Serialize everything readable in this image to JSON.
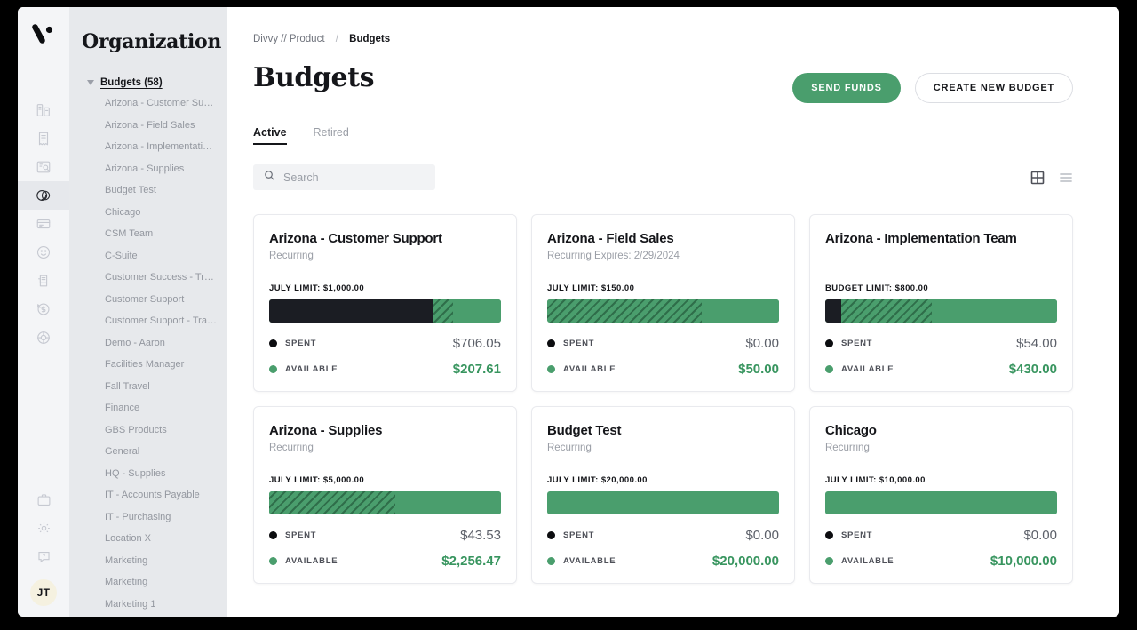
{
  "colors": {
    "accent_green": "#4a9e6d",
    "value_green": "#38955f",
    "dark": "#1b1d23"
  },
  "rail": {
    "logo": "divvy-logo",
    "icons": [
      {
        "name": "org-chart-icon"
      },
      {
        "name": "receipt-icon"
      },
      {
        "name": "transactions-icon"
      },
      {
        "name": "budgets-pie-icon",
        "active": true
      },
      {
        "name": "cards-icon"
      },
      {
        "name": "smiley-icon"
      },
      {
        "name": "bill-pay-icon"
      },
      {
        "name": "reimbursements-icon"
      },
      {
        "name": "rewards-icon"
      }
    ],
    "bottom_icons": [
      {
        "name": "briefcase-icon"
      },
      {
        "name": "gear-icon"
      },
      {
        "name": "help-icon"
      }
    ],
    "avatar_initials": "JT"
  },
  "sidebar": {
    "title": "Organization",
    "tree_label": "Budgets (58)",
    "items": [
      "Arizona - Customer Support",
      "Arizona - Field Sales",
      "Arizona - Implementation T…",
      "Arizona - Supplies",
      "Budget Test",
      "Chicago",
      "CSM Team",
      "C-Suite",
      "Customer Success - Travel …",
      "Customer Support",
      "Customer Support - Travel …",
      "Demo - Aaron",
      "Facilities Manager",
      "Fall Travel",
      "Finance",
      "GBS Products",
      "General",
      "HQ - Supplies",
      "IT - Accounts Payable",
      "IT - Purchasing",
      "Location X",
      "Marketing",
      "Marketing",
      "Marketing 1"
    ]
  },
  "breadcrumb": {
    "root": "Divvy // Product",
    "separator": "/",
    "current": "Budgets"
  },
  "header": {
    "title": "Budgets",
    "send_funds_label": "SEND FUNDS",
    "create_budget_label": "CREATE NEW BUDGET"
  },
  "tabs": [
    {
      "label": "Active",
      "active": true
    },
    {
      "label": "Retired",
      "active": false
    }
  ],
  "search": {
    "placeholder": "Search",
    "value": "",
    "icon": "search-icon"
  },
  "view_toggles": [
    {
      "name": "grid-view-icon",
      "active": true
    },
    {
      "name": "list-view-icon",
      "active": false
    }
  ],
  "cards": [
    {
      "title": "Arizona - Customer Support",
      "subtitle": "Recurring",
      "limit_label": "JULY LIMIT: $1,000.00",
      "spent_label": "SPENT",
      "spent_value": "$706.05",
      "available_label": "AVAILABLE",
      "available_value": "$207.61",
      "bar": {
        "spent_pct": 70.6,
        "hatch_pct": 8.7
      }
    },
    {
      "title": "Arizona - Field Sales",
      "subtitle": "Recurring Expires: 2/29/2024",
      "limit_label": "JULY LIMIT: $150.00",
      "spent_label": "SPENT",
      "spent_value": "$0.00",
      "available_label": "AVAILABLE",
      "available_value": "$50.00",
      "bar": {
        "spent_pct": 0,
        "hatch_pct": 66.6
      }
    },
    {
      "title": "Arizona - Implementation Team",
      "subtitle": "",
      "limit_label": "BUDGET LIMIT: $800.00",
      "spent_label": "SPENT",
      "spent_value": "$54.00",
      "available_label": "AVAILABLE",
      "available_value": "$430.00",
      "bar": {
        "spent_pct": 6.8,
        "hatch_pct": 39.2
      }
    },
    {
      "title": "Arizona - Supplies",
      "subtitle": "Recurring",
      "limit_label": "JULY LIMIT: $5,000.00",
      "spent_label": "SPENT",
      "spent_value": "$43.53",
      "available_label": "AVAILABLE",
      "available_value": "$2,256.47",
      "bar": {
        "spent_pct": 0,
        "hatch_pct": 54.5
      }
    },
    {
      "title": "Budget Test",
      "subtitle": "Recurring",
      "limit_label": "JULY LIMIT: $20,000.00",
      "spent_label": "SPENT",
      "spent_value": "$0.00",
      "available_label": "AVAILABLE",
      "available_value": "$20,000.00",
      "bar": {
        "spent_pct": 0,
        "hatch_pct": 0
      }
    },
    {
      "title": "Chicago",
      "subtitle": "Recurring",
      "limit_label": "JULY LIMIT: $10,000.00",
      "spent_label": "SPENT",
      "spent_value": "$0.00",
      "available_label": "AVAILABLE",
      "available_value": "$10,000.00",
      "bar": {
        "spent_pct": 0,
        "hatch_pct": 0
      }
    }
  ]
}
